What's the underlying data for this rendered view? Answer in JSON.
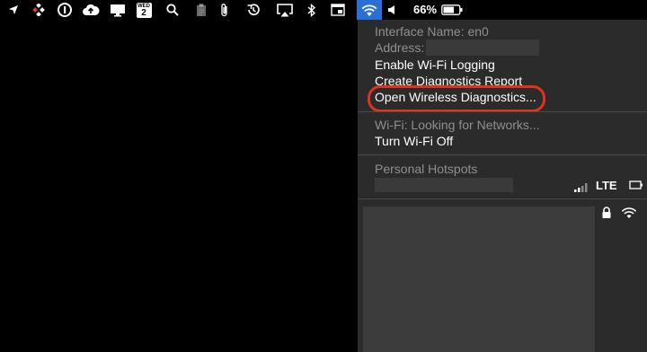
{
  "menubar": {
    "calendar_day": "WED",
    "calendar_date": "2",
    "battery_percent": "66%",
    "icons": [
      "location-arrow-icon",
      "dropbox-like-icon",
      "onepassword-icon",
      "cloud-upload-icon",
      "display-icon",
      "calendar-icon",
      "search-icon",
      "clipboard-icon",
      "paperclip-icon",
      "time-machine-icon",
      "airplay-icon",
      "bluetooth-icon",
      "screen-icon",
      "wifi-icon",
      "volume-icon",
      "battery-icon"
    ]
  },
  "wifi_menu": {
    "interface_name": "Interface Name: en0",
    "address_label": "Address:",
    "enable_logging": "Enable Wi-Fi Logging",
    "create_report": "Create Diagnostics Report",
    "open_diagnostics": "Open Wireless Diagnostics...",
    "wifi_status": "Wi-Fi: Looking for Networks...",
    "turn_off": "Turn Wi-Fi Off",
    "personal_hotspots": "Personal Hotspots",
    "lte": "LTE"
  },
  "colors": {
    "menu_bg": "#2b2b2b",
    "wifi_active_bg": "#2a6fd6",
    "highlight_ring": "#e0321e"
  }
}
